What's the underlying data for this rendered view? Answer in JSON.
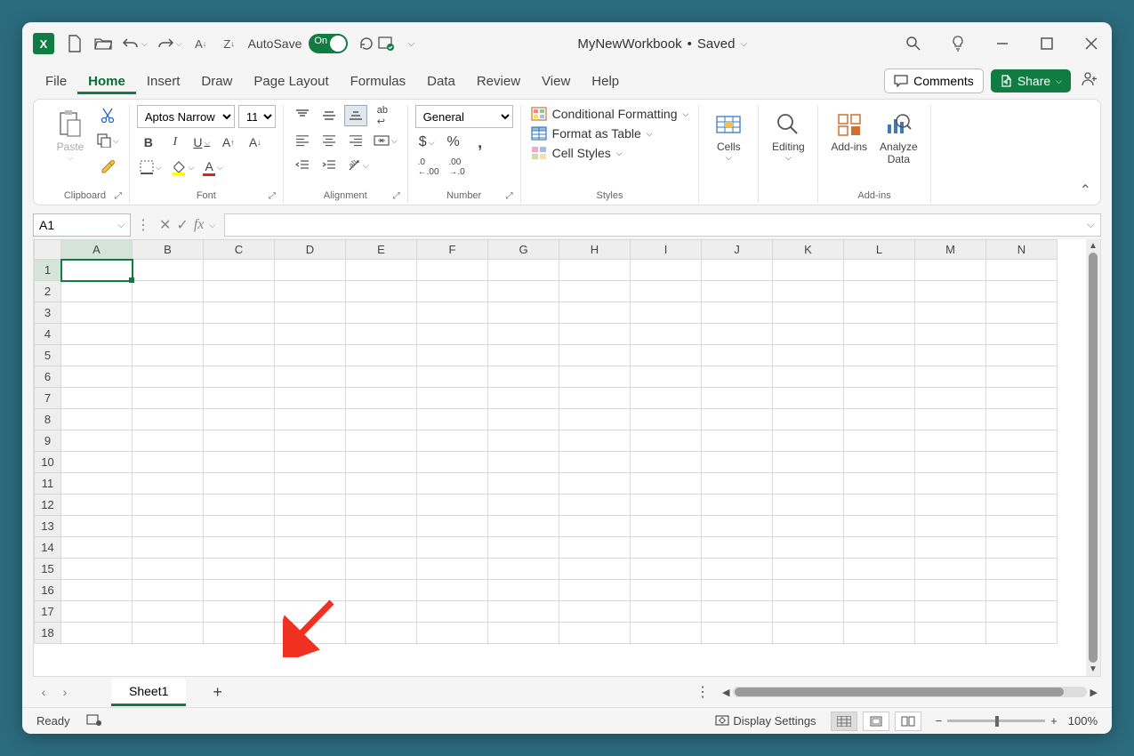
{
  "app": {
    "icon_text": "X"
  },
  "titlebar": {
    "autosave_label": "AutoSave",
    "autosave_state": "On",
    "document_name": "MyNewWorkbook",
    "save_state": "Saved"
  },
  "tabs": {
    "items": [
      "File",
      "Home",
      "Insert",
      "Draw",
      "Page Layout",
      "Formulas",
      "Data",
      "Review",
      "View",
      "Help"
    ],
    "active_index": 1,
    "comments_label": "Comments",
    "share_label": "Share"
  },
  "ribbon": {
    "clipboard": {
      "paste_label": "Paste",
      "group_label": "Clipboard"
    },
    "font": {
      "font_name": "Aptos Narrow",
      "font_size": "11",
      "group_label": "Font"
    },
    "alignment": {
      "group_label": "Alignment"
    },
    "number": {
      "format": "General",
      "group_label": "Number"
    },
    "styles": {
      "conditional": "Conditional Formatting",
      "table": "Format as Table",
      "cell": "Cell Styles",
      "group_label": "Styles"
    },
    "cells": {
      "label": "Cells"
    },
    "editing": {
      "label": "Editing"
    },
    "addins": {
      "label": "Add-ins",
      "group_label": "Add-ins"
    },
    "analyze": {
      "label1": "Analyze",
      "label2": "Data"
    }
  },
  "formula_bar": {
    "name_box": "A1"
  },
  "grid": {
    "columns": [
      "A",
      "B",
      "C",
      "D",
      "E",
      "F",
      "G",
      "H",
      "I",
      "J",
      "K",
      "L",
      "M",
      "N"
    ],
    "rows": [
      1,
      2,
      3,
      4,
      5,
      6,
      7,
      8,
      9,
      10,
      11,
      12,
      13,
      14,
      15,
      16,
      17,
      18
    ],
    "selected_cell": "A1"
  },
  "sheets": {
    "active": "Sheet1"
  },
  "status": {
    "ready": "Ready",
    "display_settings": "Display Settings",
    "zoom": "100%"
  }
}
